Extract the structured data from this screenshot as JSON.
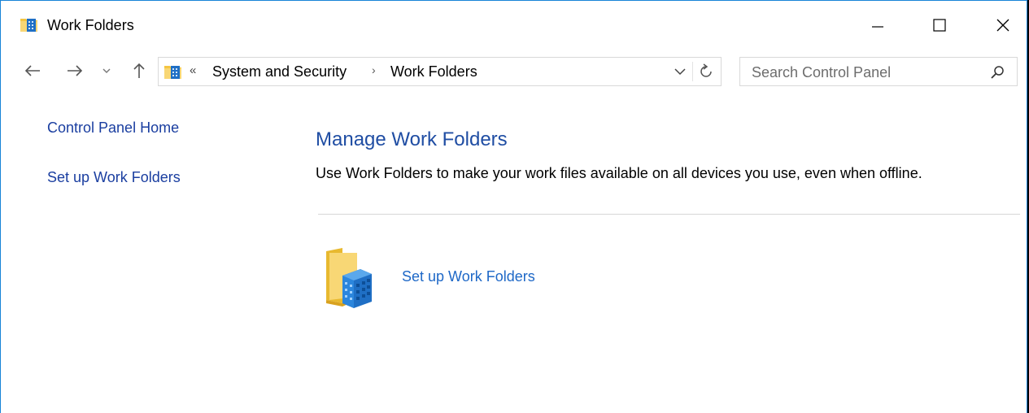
{
  "window": {
    "title": "Work Folders",
    "accent_color": "#1883d7"
  },
  "titlebar": {
    "icon": "work-folders-icon",
    "minimize_icon": "minimize-icon",
    "maximize_icon": "maximize-icon",
    "close_icon": "close-icon"
  },
  "navigation": {
    "back_icon": "arrow-left-icon",
    "forward_icon": "arrow-right-icon",
    "recent_icon": "chevron-down-icon",
    "up_icon": "arrow-up-icon"
  },
  "address_bar": {
    "overflow_chevron": "«",
    "breadcrumbs": [
      "System and Security",
      "Work Folders"
    ],
    "separator": "›",
    "dropdown_icon": "chevron-down-icon",
    "refresh_icon": "refresh-icon"
  },
  "search": {
    "placeholder": "Search Control Panel",
    "icon": "search-icon"
  },
  "left_pane": {
    "links": [
      "Control Panel Home",
      "Set up Work Folders"
    ]
  },
  "main": {
    "title": "Manage Work Folders",
    "description": "Use Work Folders to make your work files available on all devices you use, even when offline.",
    "task": {
      "label": "Set up Work Folders",
      "icon": "work-folders-large-icon"
    }
  },
  "colors": {
    "link": "#1a3ea0",
    "heading": "#1f4da3",
    "task_link": "#1e68c7"
  }
}
